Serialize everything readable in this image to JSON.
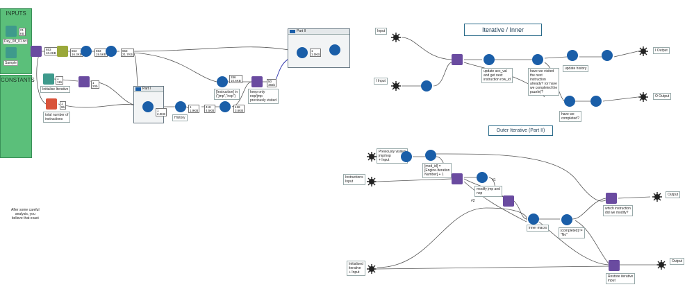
{
  "inputs_panel": {
    "title": "INPUTS",
    "file1": "Day_08_01.txt",
    "file2": "Sample"
  },
  "constants_panel": {
    "title": "CONSTANTS"
  },
  "counts": {
    "c1": "653\n10.2KB",
    "c2": "653\n16.3KB",
    "c3": "653\n19.5KB",
    "c4": "653\n21.7KB",
    "c5": "1\n11b",
    "c6": "1\n20b",
    "c7": "1\n9b",
    "c8": "1\n2.0KB",
    "c9": "1\n1.9KB",
    "c10": "418\n4.5KB",
    "c11": "418\n3.6KB",
    "c12": "286\n10.6KB",
    "c13": "50\n465b",
    "c14": "1\n1.0KB",
    "c15": "1\n1KB"
  },
  "labels": {
    "initialise": "Initialise Iterative",
    "total": "total number of\ninstructions",
    "history": "History",
    "instr_in": "[Instruction] in\n(\"jmp\",\"nop\")",
    "keep_only": "keep only\nnop/jmp\npreviously visited",
    "note": "After some careful\nanalysis, you\nbelieve that exact"
  },
  "containers": {
    "part1": "Part I",
    "part2": "Part II"
  },
  "inner": {
    "title": "Iterative / Inner",
    "input_top": "Input",
    "input_mid": "I Input",
    "update_acc": "update acc_val\nand get next\ninstruction row_id",
    "visited": "have we visited\nthe next\ninstruction\nalready? (or have\nwe completed the\npuzzle)?",
    "update_history": "update history",
    "completed": "have we\ncompleted?",
    "output_top": "I Output",
    "output_bot": "O Output"
  },
  "outer": {
    "title": "Outer Iterative (Part II)",
    "prev_visited": "Previously visited\njmp/nop\n+ Input",
    "mod_id": "[mod_id] =\n[Engine.Iteration\nNumber] + 1",
    "instructions_input": "Instructions\nInput",
    "modify": "modify jmp and\nnop",
    "inner_macro": "inner macro",
    "completed_no": "[completed] !=\n\"No\"",
    "which": "which instruction\ndid we modify?",
    "output1": "Output",
    "init_outer": "Initialised\niterative\n+ Input",
    "restore": "Restore iterative\ninput",
    "output2": "Output",
    "anchor1": "#1",
    "anchor2": "#2"
  },
  "colors": {
    "accent_green": "#5bbf7a",
    "tool_blue": "#1a5ea8",
    "conn_blue": "#3a3fb0"
  }
}
